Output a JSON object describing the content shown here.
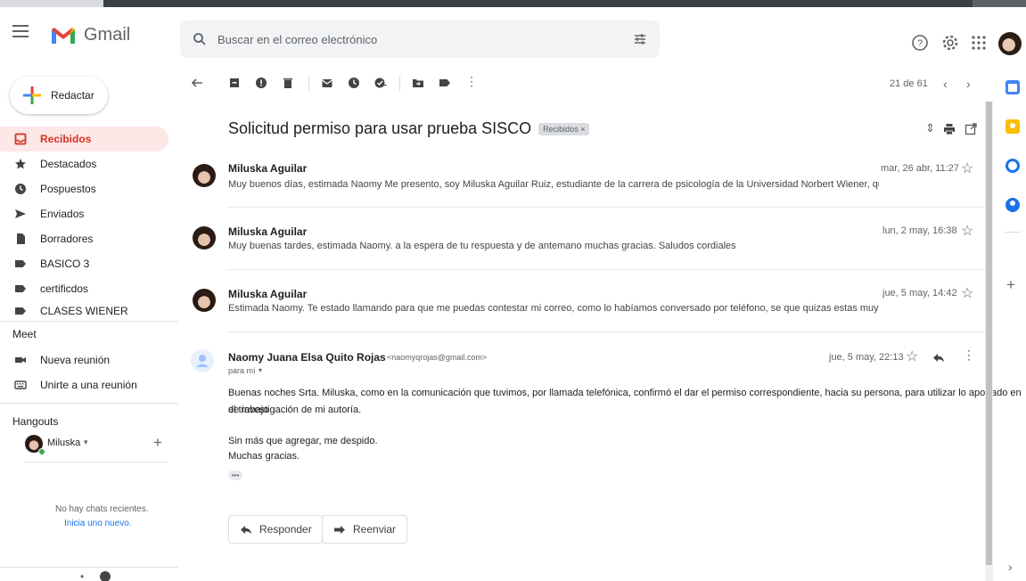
{
  "header": {
    "app_name": "Gmail",
    "search_placeholder": "Buscar en el correo electrónico"
  },
  "sidebar": {
    "compose_label": "Redactar",
    "items": [
      {
        "label": "Recibidos",
        "icon": "inbox-icon",
        "active": true
      },
      {
        "label": "Destacados",
        "icon": "star-icon"
      },
      {
        "label": "Pospuestos",
        "icon": "clock-icon"
      },
      {
        "label": "Enviados",
        "icon": "send-icon"
      },
      {
        "label": "Borradores",
        "icon": "draft-icon"
      },
      {
        "label": "BASICO 3",
        "icon": "label-icon"
      },
      {
        "label": "certificdos",
        "icon": "label-icon"
      },
      {
        "label": "CLASES WIENER",
        "icon": "label-icon"
      }
    ],
    "meet": {
      "title": "Meet",
      "new_meeting": "Nueva reunión",
      "join_meeting": "Unirte a una reunión"
    },
    "hangouts": {
      "title": "Hangouts",
      "user": "Miluska",
      "no_chats": "No hay chats recientes.",
      "start_new": "Inicia uno nuevo."
    }
  },
  "toolbar": {
    "pager": "21 de 61"
  },
  "thread": {
    "subject": "Solicitud permiso para usar prueba SISCO",
    "label_chip": "Recibidos ×",
    "messages": [
      {
        "sender": "Miluska Aguilar",
        "date": "mar, 26 abr, 11:27",
        "snippet": "Muy buenos días, estimada Naomy Me presento, soy Miluska Aguilar Ruiz, estudiante de la carrera de psicología de la Universidad Norbert Wiener, quisiera solicit"
      },
      {
        "sender": "Miluska Aguilar",
        "date": "lun, 2 may, 16:38",
        "snippet": "Muy buenas tardes, estimada Naomy. a la espera de tu respuesta y de antemano muchas gracias. Saludos cordiales"
      },
      {
        "sender": "Miluska Aguilar",
        "date": "jue, 5 may, 14:42",
        "snippet": "Estimada Naomy. Te estado llamando para que me puedas contestar mi correo, como lo habíamos conversado por teléfono, se que quizas estas muy ocupada, pero te ag"
      }
    ],
    "expanded": {
      "sender": "Naomy Juana Elsa Quito Rojas",
      "email": "<naomyqrojas@gmail.com>",
      "to": "para mí",
      "date": "jue, 5 may, 22:13",
      "body_line1": "Buenas noches Srta. Miluska, como en la comunicación que tuvimos, por llamada telefónica, confirmó el dar el permiso correspondiente, hacia su persona, para utilizar lo aportado en el trabajo",
      "body_line2": "de investigación de mi autoría.",
      "body_line3": "Sin más que agregar, me despido.",
      "body_line4": "Muchas gracias.",
      "ellipsis": "•••"
    },
    "reply_label": "Responder",
    "forward_label": "Reenviar"
  },
  "colors": {
    "accent_red": "#d93025",
    "active_bg": "#fce8e6"
  }
}
